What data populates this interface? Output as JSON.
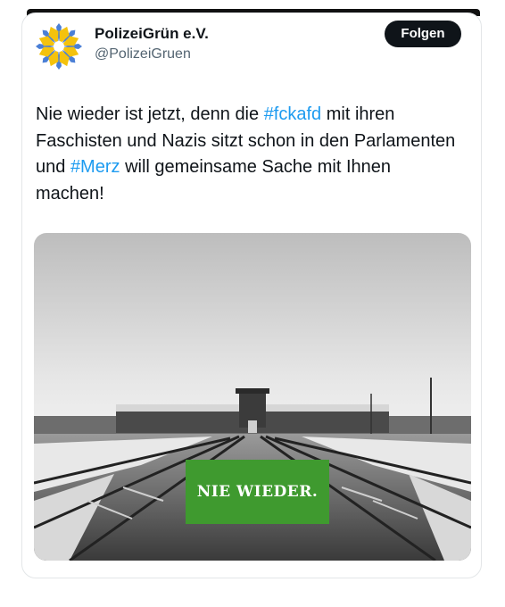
{
  "account": {
    "name": "PolizeiGrün e.V.",
    "handle": "@PolizeiGruen",
    "avatar_icon": "sun-flower-icon",
    "colors": {
      "avatar_blue": "#4a7fd6",
      "avatar_yellow": "#f4c20d"
    }
  },
  "follow_label": "Folgen",
  "tweet": {
    "part1": "Nie wieder ist jetzt, denn die ",
    "hashtag1": "#fckafd",
    "part2": " mit ihren Faschisten und Nazis sitzt schon in den Parlamenten und ",
    "hashtag2": "#Merz",
    "part3": " will gemeinsame Sache mit Ihnen machen!",
    "hashtag_color": "#1d9bf0"
  },
  "media": {
    "badge_text": "NIE WIEDER.",
    "badge_color": "#3f9a2f"
  }
}
